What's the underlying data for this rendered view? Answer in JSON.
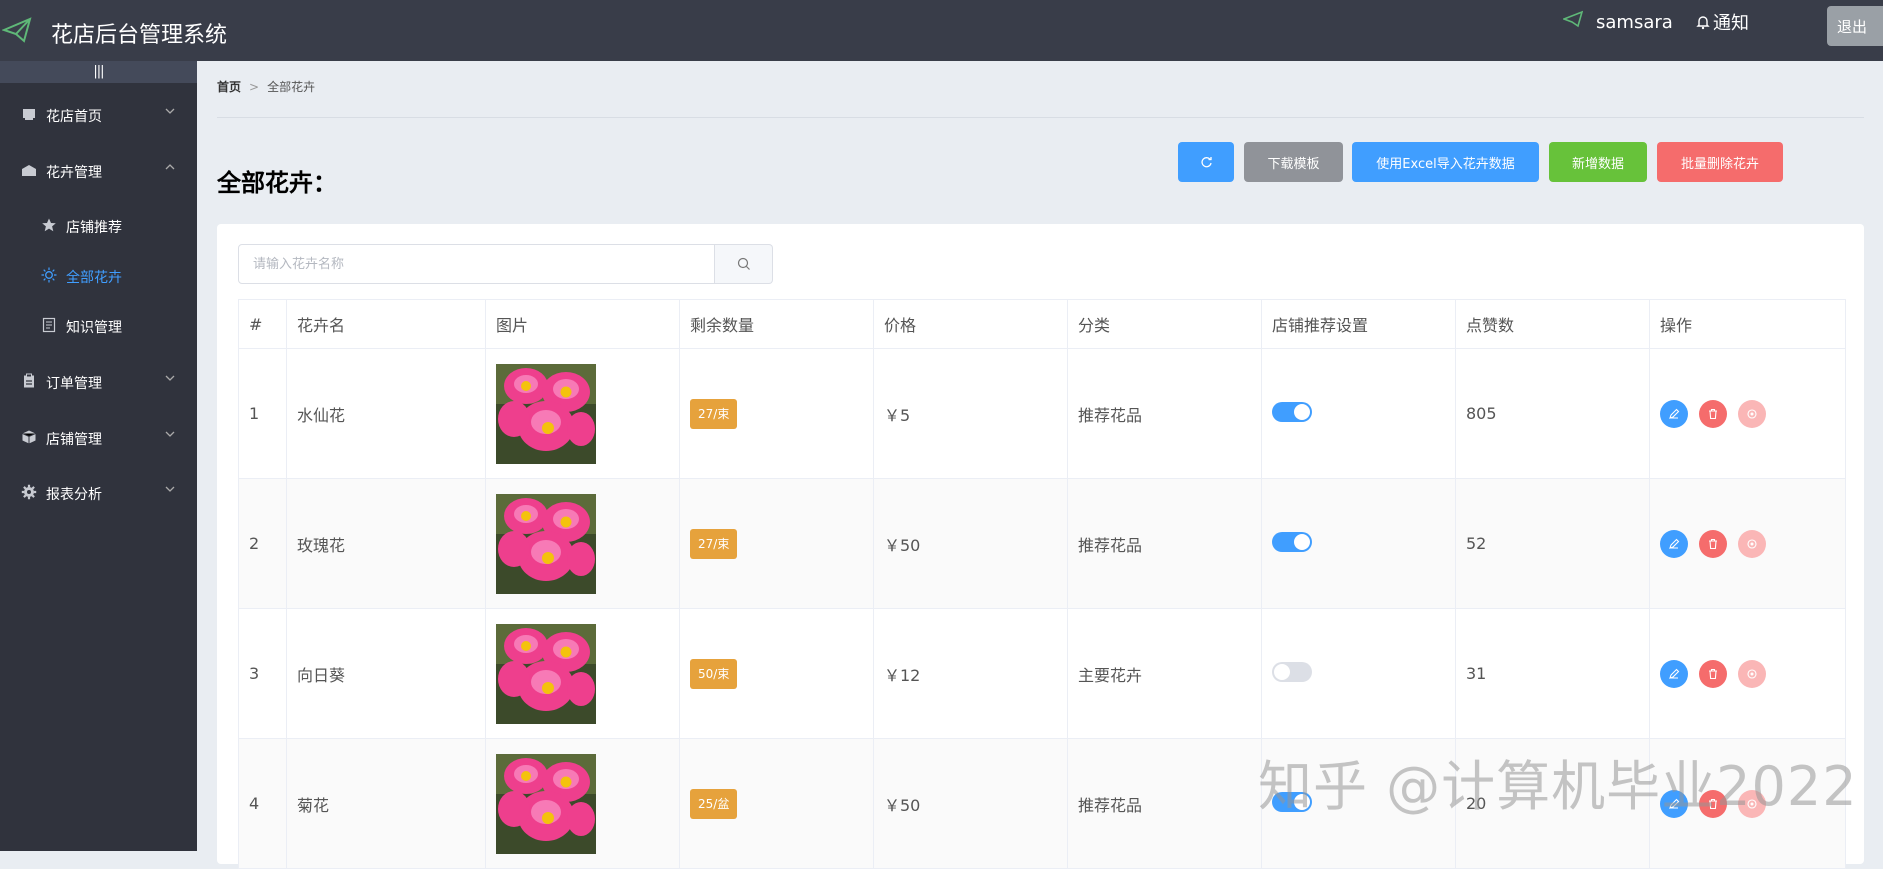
{
  "header": {
    "title": "花店后台管理系统",
    "username": "samsara",
    "notify_label": "通知",
    "logout_label": "退出"
  },
  "sidebar": {
    "toggle_glyph": "|||",
    "items": [
      {
        "label": "花店首页",
        "icon": "shop-icon"
      },
      {
        "label": "花卉管理",
        "icon": "building-icon"
      },
      {
        "label": "店铺推荐",
        "icon": "star-icon"
      },
      {
        "label": "全部花卉",
        "icon": "sun-icon"
      },
      {
        "label": "知识管理",
        "icon": "document-icon"
      },
      {
        "label": "订单管理",
        "icon": "clipboard-icon"
      },
      {
        "label": "店铺管理",
        "icon": "box-icon"
      },
      {
        "label": "报表分析",
        "icon": "gear-icon"
      }
    ],
    "accent": "#409eff"
  },
  "breadcrumb": {
    "home": "首页",
    "current": "全部花卉"
  },
  "page": {
    "title": "全部花卉："
  },
  "toolbar": {
    "template_label": "下载模板",
    "import_label": "使用Excel导入花卉数据",
    "add_label": "新增数据",
    "batch_delete_label": "批量删除花卉"
  },
  "search": {
    "placeholder": "请输入花卉名称",
    "value": ""
  },
  "table": {
    "headers": [
      "#",
      "花卉名",
      "图片",
      "剩余数量",
      "价格",
      "分类",
      "店铺推荐设置",
      "点赞数",
      "操作"
    ],
    "rows": [
      {
        "index": "1",
        "name": "水仙花",
        "quantity": "27/束",
        "price": "￥5",
        "category": "推荐花品",
        "recommended": true,
        "likes": "805"
      },
      {
        "index": "2",
        "name": "玫瑰花",
        "quantity": "27/束",
        "price": "￥50",
        "category": "推荐花品",
        "recommended": true,
        "likes": "52"
      },
      {
        "index": "3",
        "name": "向日葵",
        "quantity": "50/束",
        "price": "￥12",
        "category": "主要花卉",
        "recommended": false,
        "likes": "31"
      },
      {
        "index": "4",
        "name": "菊花",
        "quantity": "25/盆",
        "price": "￥50",
        "category": "推荐花品",
        "recommended": true,
        "likes": "20"
      }
    ]
  },
  "watermark": "知乎 @计算机毕业2022"
}
